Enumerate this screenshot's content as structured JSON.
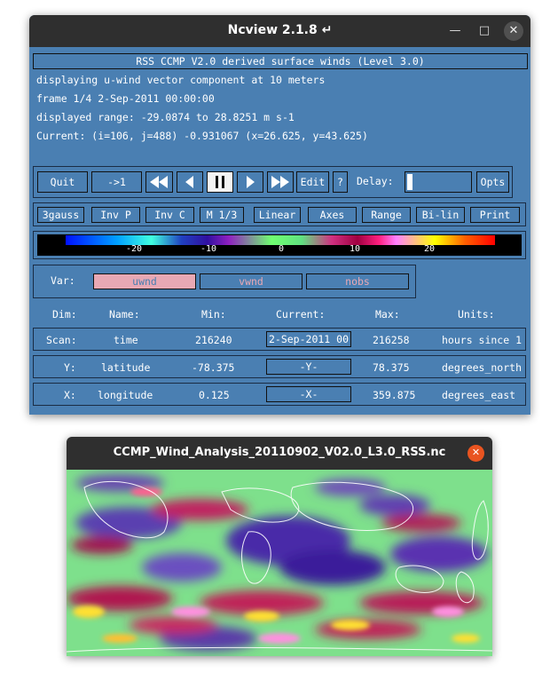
{
  "ncview": {
    "window_title": "Ncview 2.1.8",
    "title_icon": "return-arrow-icon",
    "dataset_label": "RSS CCMP V2.0 derived surface winds (Level 3.0)",
    "info": {
      "line1": "displaying u-wind vector component at 10 meters",
      "line2": "frame 1/4 2-Sep-2011 00:00:00",
      "line3": "displayed range: -29.0874 to 28.8251 m s-1",
      "line4": "Current: (i=106, j=488) -0.931067 (x=26.625, y=43.625)"
    },
    "controls": {
      "quit": "Quit",
      "step": "->1",
      "edit": "Edit",
      "help": "?",
      "delay_label": "Delay:",
      "opts": "Opts"
    },
    "options": [
      "3gauss",
      "Inv P",
      "Inv C",
      "M 1/3",
      "Linear",
      "Axes",
      "Range",
      "Bi-lin",
      "Print"
    ],
    "colorbar_ticks": [
      "-20",
      "-10",
      "0",
      "10",
      "20"
    ],
    "var_label": "Var:",
    "vars": [
      "uwnd",
      "vwnd",
      "nobs"
    ],
    "dim_headers": {
      "dim": "Dim:",
      "name": "Name:",
      "min": "Min:",
      "current": "Current:",
      "max": "Max:",
      "units": "Units:"
    },
    "dims": [
      {
        "dim": "Scan:",
        "name": "time",
        "min": "216240",
        "current": "2-Sep-2011 00",
        "max": "216258",
        "units": "hours since 1"
      },
      {
        "dim": "Y:",
        "name": "latitude",
        "min": "-78.375",
        "current": "-Y-",
        "max": "78.375",
        "units": "degrees_north"
      },
      {
        "dim": "X:",
        "name": "longitude",
        "min": "0.125",
        "current": "-X-",
        "max": "359.875",
        "units": "degrees_east"
      }
    ]
  },
  "map_window": {
    "title": "CCMP_Wind_Analysis_20110902_V02.0_L3.0_RSS.nc"
  },
  "colors": {
    "panel_bg": "#4a7fb2",
    "titlebar_bg": "#2f2f2f",
    "selected_var_bg": "#e8a8b4",
    "var_text": "#e8a8b4",
    "close_orange": "#e95420"
  }
}
